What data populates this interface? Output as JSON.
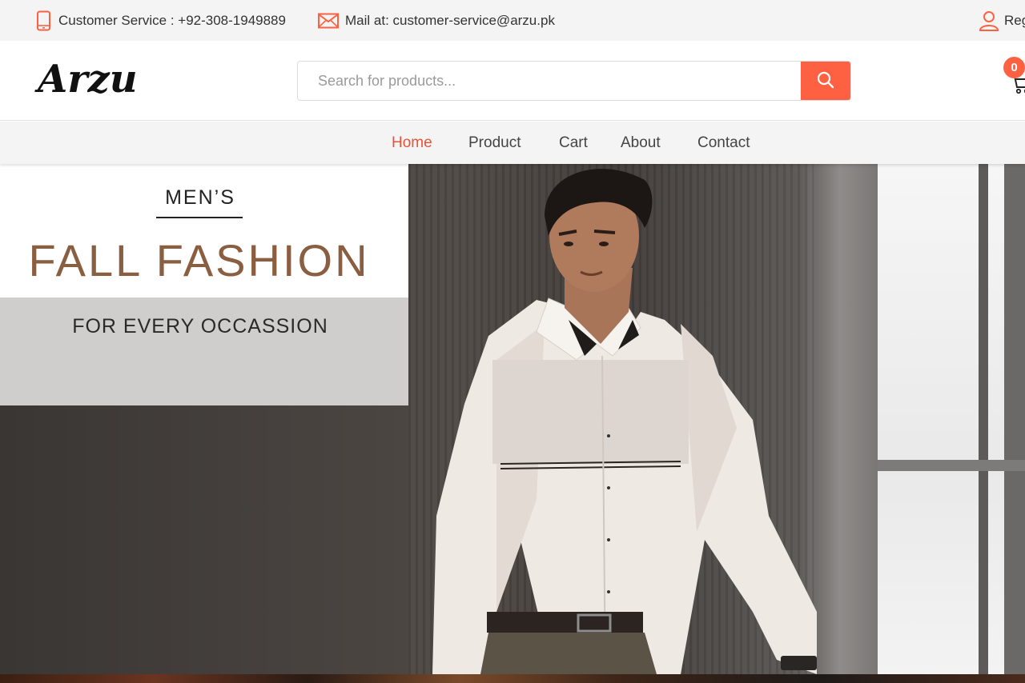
{
  "topbar": {
    "customer_service": "Customer Service : +92-308-1949889",
    "mail": "Mail at: customer-service@arzu.pk",
    "register": "Reg",
    "icons": {
      "phone": "mobile-phone-icon",
      "mail": "envelope-icon",
      "user": "user-icon"
    },
    "icon_color": "#fd6141"
  },
  "header": {
    "logo": "Arzu",
    "search": {
      "placeholder": "Search for products...",
      "value": ""
    },
    "search_icon": "search-icon",
    "cart": {
      "count": "0",
      "icon": "cart-icon"
    },
    "accent_color": "#fd6141"
  },
  "nav": {
    "items": [
      {
        "label": "Home",
        "active": true
      },
      {
        "label": "Product",
        "active": false
      },
      {
        "label": "Cart",
        "active": false
      },
      {
        "label": "About",
        "active": false
      },
      {
        "label": "Contact",
        "active": false
      }
    ],
    "active_color": "#e5533a"
  },
  "hero": {
    "kicker": "MEN’S",
    "headline": "FALL FASHION",
    "subline": "FOR EVERY OCCASSION",
    "headline_color": "#8a5e40"
  }
}
